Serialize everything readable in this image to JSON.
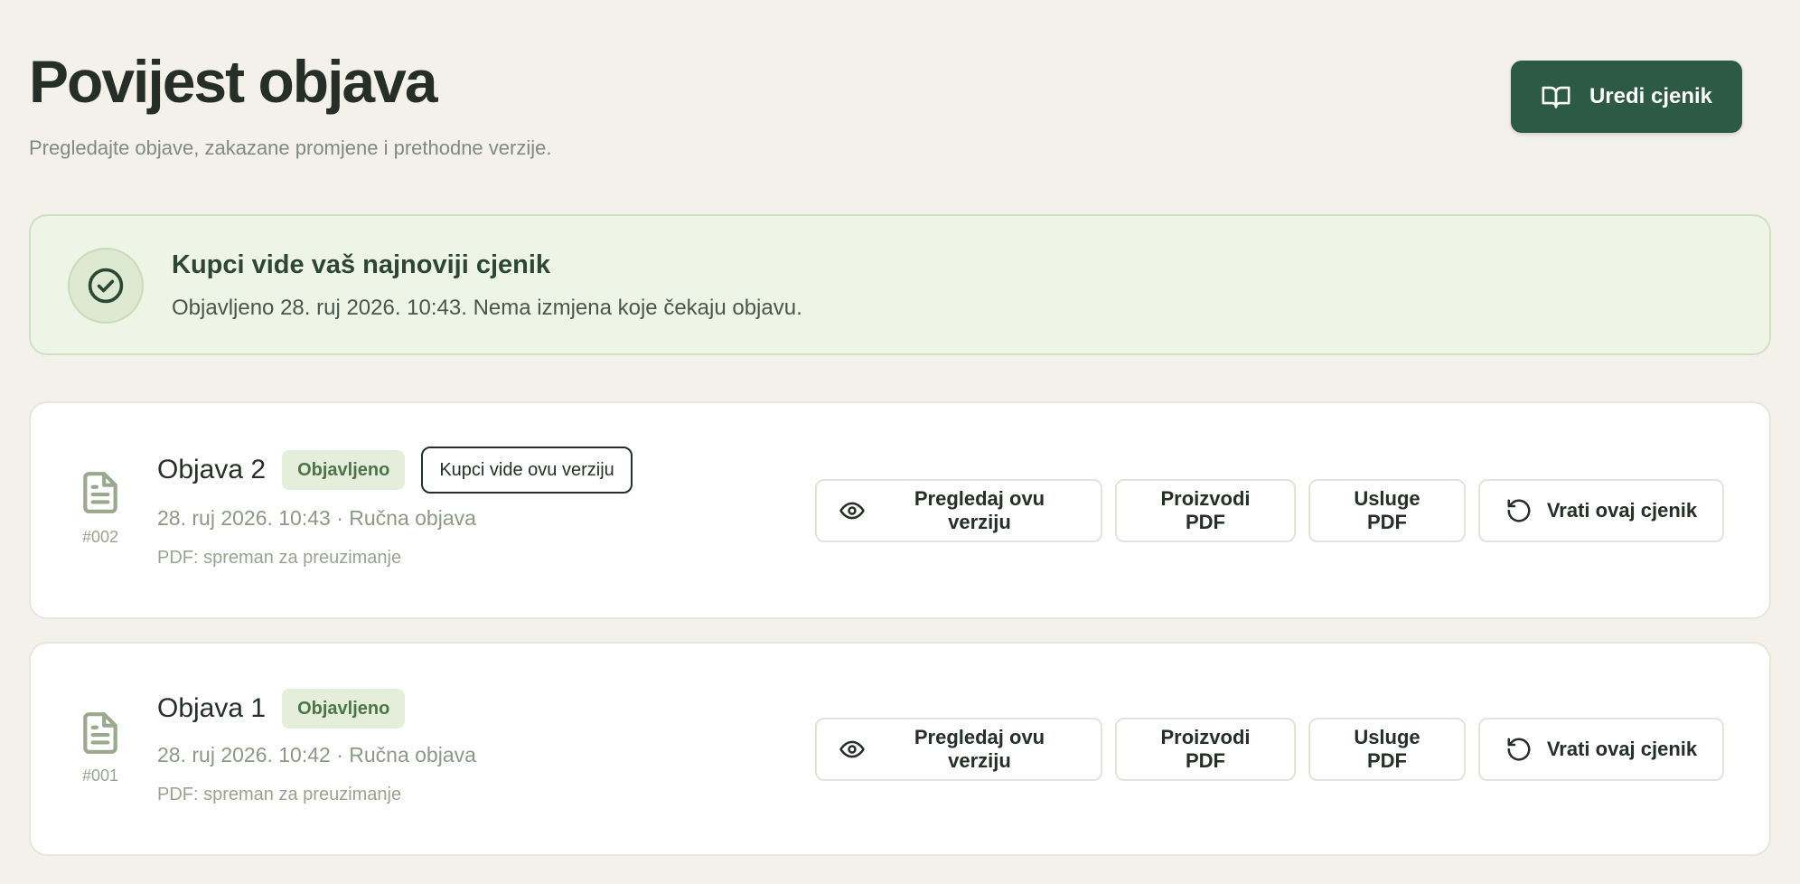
{
  "header": {
    "title": "Povijest objava",
    "subtitle": "Pregledajte objave, zakazane promjene i prethodne verzije.",
    "edit_button": {
      "label": "Uredi cjenik",
      "icon": "book-icon"
    }
  },
  "notice": {
    "icon": "check-circle-icon",
    "title": "Kupci vide vaš najnoviji cjenik",
    "text": "Objavljeno 28. ruj 2026. 10:43. Nema izmjena koje čekaju objavu."
  },
  "publications": [
    {
      "number": "#002",
      "title": "Objava 2",
      "status": "Objavljeno",
      "current_badge": "Kupci vide ovu verziju",
      "meta": "28. ruj 2026. 10:43 · Ručna objava",
      "pdf_status": "PDF: spreman za preuzimanje",
      "actions": {
        "preview": "Pregledaj ovu verziju",
        "products_pdf": "Proizvodi PDF",
        "services_pdf": "Usluge PDF",
        "restore": "Vrati ovaj cjenik"
      }
    },
    {
      "number": "#001",
      "title": "Objava 1",
      "status": "Objavljeno",
      "meta": "28. ruj 2026. 10:42 · Ručna objava",
      "pdf_status": "PDF: spreman za preuzimanje",
      "actions": {
        "preview": "Pregledaj ovu verziju",
        "products_pdf": "Proizvodi PDF",
        "services_pdf": "Usluge PDF",
        "restore": "Vrati ovaj cjenik"
      }
    }
  ],
  "colors": {
    "background": "#f3f1ea",
    "primary": "#2d5a45",
    "notice_bg": "#eef4e6",
    "badge_bg": "#e5eddb",
    "badge_text": "#4b7548"
  }
}
